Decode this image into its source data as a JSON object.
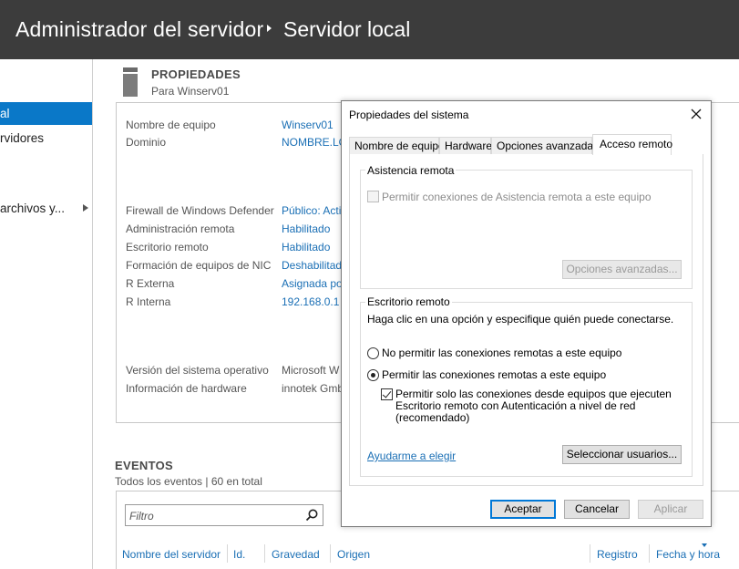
{
  "titlebar": {
    "app": "Administrador del servidor",
    "page": "Servidor local"
  },
  "nav": {
    "items": [
      {
        "label": "al",
        "active": true
      },
      {
        "label": "rvidores",
        "active": false
      },
      {
        "label": " archivos y...",
        "active": false
      }
    ]
  },
  "properties": {
    "title": "PROPIEDADES",
    "subtitle": "Para Winserv01",
    "rows": [
      {
        "label": "Nombre de equipo",
        "value": "Winserv01"
      },
      {
        "label": "Dominio",
        "value": "NOMBRE.LO"
      },
      {
        "label": "Firewall de Windows Defender",
        "value": "Público: Acti"
      },
      {
        "label": "Administración remota",
        "value": "Habilitado"
      },
      {
        "label": "Escritorio remoto",
        "value": "Habilitado"
      },
      {
        "label": "Formación de equipos de NIC",
        "value": "Deshabilitad"
      },
      {
        "label": "R Externa",
        "value": "Asignada po"
      },
      {
        "label": "R Interna",
        "value": "192.168.0.1"
      },
      {
        "label": "Versión del sistema operativo",
        "value": "Microsoft W"
      },
      {
        "label": "Información de hardware",
        "value": "innotek Gmb"
      }
    ]
  },
  "events": {
    "title": "EVENTOS",
    "subtitle": "Todos los eventos | 60 en total",
    "filter_placeholder": "Filtro",
    "columns": [
      "Nombre del servidor",
      "Id.",
      "Gravedad",
      "Origen",
      "Registro",
      "Fecha y hora"
    ]
  },
  "dialog": {
    "title": "Propiedades del sistema",
    "tabs": [
      "Nombre de equipo",
      "Hardware",
      "Opciones avanzadas",
      "Acceso remoto"
    ],
    "active_tab": 3,
    "remote_assistance": {
      "group_label": "Asistencia remota",
      "checkbox_label": "Permitir conexiones de Asistencia remota a este equipo",
      "checked": false,
      "enabled": false,
      "advanced_button": "Opciones avanzadas..."
    },
    "remote_desktop": {
      "group_label": "Escritorio remoto",
      "instruction": "Haga clic en una opción y especifique quién puede conectarse.",
      "option_deny": "No permitir las conexiones remotas a este equipo",
      "option_allow": "Permitir las conexiones remotas a este equipo",
      "selected": "allow",
      "nla_line1": "Permitir solo las conexiones desde equipos que ejecuten",
      "nla_line2": "Escritorio remoto con Autenticación a nivel de red",
      "nla_line3": "(recomendado)",
      "nla_checked": true,
      "help_link": "Ayudarme a elegir",
      "select_users_button": "Seleccionar usuarios..."
    },
    "buttons": {
      "ok": "Aceptar",
      "cancel": "Cancelar",
      "apply": "Aplicar"
    }
  },
  "colors": {
    "titlebar_bg": "#3c3c3c",
    "nav_active_bg": "#0a78c8",
    "link": "#1a6fb5",
    "default_button_border": "#0078d7"
  }
}
